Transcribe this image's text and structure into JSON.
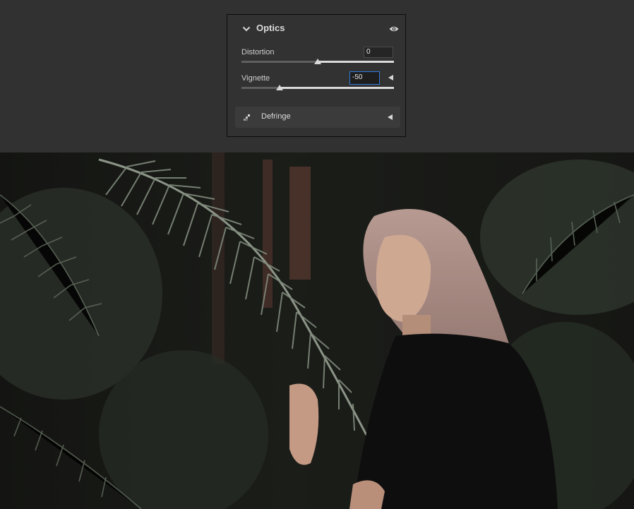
{
  "optics": {
    "title": "Optics",
    "distortion": {
      "label": "Distortion",
      "value": "0",
      "level": 0.5
    },
    "vignette": {
      "label": "Vignette",
      "value": "-50",
      "level": 0.25
    }
  },
  "defringe": {
    "label": "Defringe"
  },
  "icons": {
    "collapse": "chevron-down-icon",
    "visibility": "eye-icon",
    "reset": "triangle-left-icon",
    "defringe": "defringe-icon"
  },
  "colors": {
    "panel_bg": "#323232",
    "active_field_border": "#2f7bdc",
    "fern": "#6f7a6d"
  },
  "photo": {
    "subject": "woman-among-ferns"
  }
}
